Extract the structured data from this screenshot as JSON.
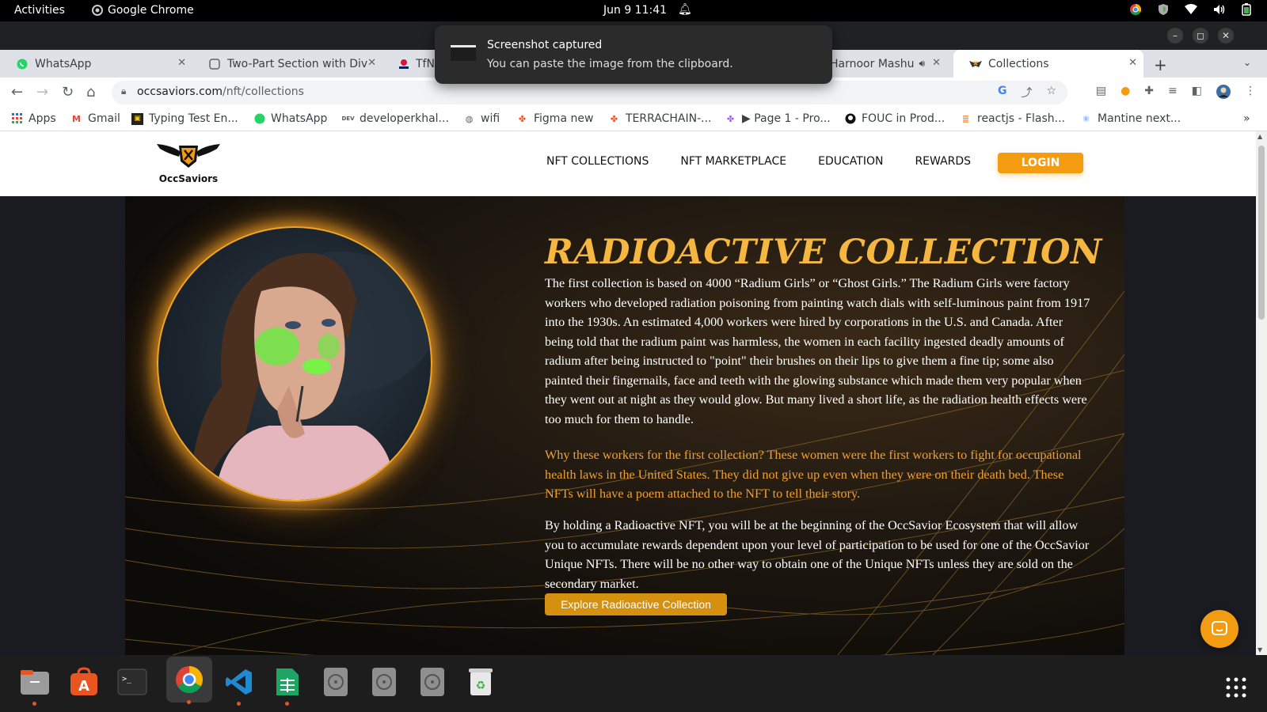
{
  "topbar": {
    "activities": "Activities",
    "app_name": "Google Chrome",
    "clock": "Jun 9  11:41"
  },
  "notification": {
    "title": "Screenshot captured",
    "body": "You can paste the image from the clipboard."
  },
  "tabs": [
    {
      "label": "WhatsApp",
      "favicon": "whatsapp-icon"
    },
    {
      "label": "Two-Part Section with Div",
      "favicon": "page-icon"
    },
    {
      "label": "TfNS",
      "favicon": "nsw-icon"
    },
    {
      "label": "Harnoor Mashu",
      "favicon": "youtube-icon"
    },
    {
      "label": "Collections",
      "favicon": "occsaviors-icon",
      "active": true
    }
  ],
  "address_bar": {
    "host": "occsaviors.com",
    "path": "/nft/collections"
  },
  "bookmarks": [
    {
      "label": "Apps",
      "icon": "apps-grid-icon"
    },
    {
      "label": "Gmail",
      "icon": "gmail-icon"
    },
    {
      "label": "Typing Test En...",
      "icon": "typing-icon"
    },
    {
      "label": "WhatsApp",
      "icon": "whatsapp-icon"
    },
    {
      "label": "developerkhal...",
      "icon": "developer-icon"
    },
    {
      "label": "wifi",
      "icon": "globe-icon"
    },
    {
      "label": "Figma new",
      "icon": "figma-icon"
    },
    {
      "label": "TERRACHAIN-...",
      "icon": "figma-icon"
    },
    {
      "label": "▶ Page 1 - Pro...",
      "icon": "figma-icon"
    },
    {
      "label": "FOUC in Prod...",
      "icon": "github-icon"
    },
    {
      "label": "reactjs - Flash...",
      "icon": "stackoverflow-icon"
    },
    {
      "label": "Mantine next...",
      "icon": "react-icon"
    }
  ],
  "site": {
    "brand": "OccSaviors",
    "nav": [
      "NFT COLLECTIONS",
      "NFT MARKETPLACE",
      "EDUCATION",
      "REWARDS"
    ],
    "login": "LOGIN"
  },
  "hero": {
    "title": "RADIOACTIVE COLLECTION",
    "p1": "The first collection is based on 4000 “Radium Girls” or “Ghost Girls.” The Radium Girls were factory workers who developed radiation poisoning from painting watch dials with self-luminous paint from 1917 into the 1930s. An estimated 4,000 workers were hired by corporations in the U.S. and Canada. After being told that the radium paint was harmless, the women in each facility ingested deadly amounts of radium after being instructed to \"point\" their brushes on their lips to give them a fine tip; some also painted their fingernails, face and teeth with the glowing substance which made them very popular when they went out at night as they would glow. But many lived a short life, as the radiation health effects were too much for them to handle.",
    "p2": "Why these workers for the first collection? These women were the first workers to fight for occupational health laws in the United States. They did not give up even when they were on their death bed. These NFTs will have a poem attached to the NFT to tell their story.",
    "p3": "By holding a Radioactive NFT, you will be at the beginning of the OccSavior Ecosystem that will allow you to accumulate rewards dependent upon your level of participation to be used for one of the OccSavior Unique NFTs. There will be no other way to obtain one of the Unique NFTs unless they are sold on the secondary market.",
    "button": "Explore Radioactive Collection"
  },
  "colors": {
    "accent": "#f39c12",
    "title_gold": "#f5b740",
    "highlight_text": "#f0a030"
  }
}
